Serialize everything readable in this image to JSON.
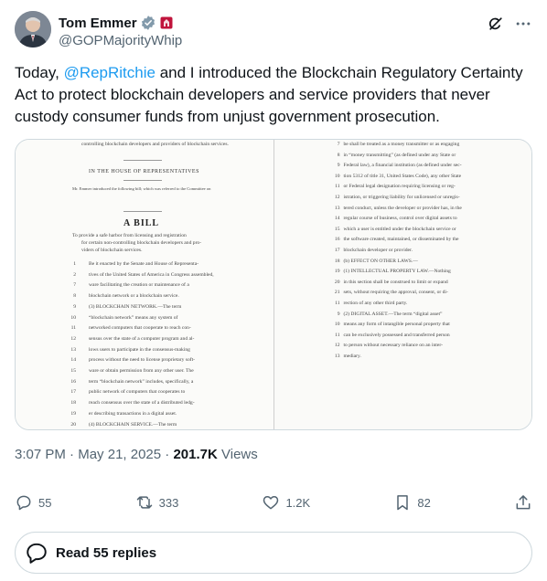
{
  "author": {
    "display_name": "Tom Emmer",
    "handle": "@GOPMajorityWhip",
    "verified_badge_color": "#829aab",
    "affiliation_badge_color": "#c0143c"
  },
  "tweet": {
    "text_before": "Today, ",
    "mention": "@RepRitchie",
    "text_after": " and I introduced the Blockchain Regulatory Certainty Act to protect blockchain developers and service providers that never custody consumer funds from unjust government prosecution."
  },
  "document": {
    "left_page": {
      "top_line": "controlling blockchain developers and providers of blockchain services.",
      "house": "IN THE HOUSE OF REPRESENTATIVES",
      "intro": "Mr. Emmer introduced the following bill; which was referred to the Committee on",
      "title": "A BILL",
      "purpose": [
        "To provide a safe harbor from licensing and registration",
        "for certain non-controlling blockchain developers and pro-",
        "viders of blockchain services."
      ],
      "numbered_lines": [
        {
          "n": "1",
          "t": "Be it enacted by the Senate and House of Representa-"
        },
        {
          "n": "2",
          "t": "tives of the United States of America in Congress assembled,"
        },
        {
          "n": "7",
          "t": "ware facilitating the creation or maintenance of a"
        },
        {
          "n": "8",
          "t": "blockchain network or a blockchain service."
        },
        {
          "n": "9",
          "t": "(3) BLOCKCHAIN NETWORK.—The term"
        },
        {
          "n": "10",
          "t": "“blockchain network” means any system of"
        },
        {
          "n": "11",
          "t": "networked computers that cooperate to reach con-"
        },
        {
          "n": "12",
          "t": "sensus over the state of a computer program and al-"
        },
        {
          "n": "13",
          "t": "lows users to participate in the consensus-making"
        },
        {
          "n": "14",
          "t": "process without the need to license proprietary soft-"
        },
        {
          "n": "15",
          "t": "ware or obtain permission from any other user. The"
        },
        {
          "n": "16",
          "t": "term “blockchain network” includes, specifically, a"
        },
        {
          "n": "17",
          "t": "public network of computers that cooperates to"
        },
        {
          "n": "18",
          "t": "reach consensus over the state of a distributed ledg-"
        },
        {
          "n": "19",
          "t": "er describing transactions in a digital asset."
        },
        {
          "n": "20",
          "t": "(4) BLOCKCHAIN SERVICE.—The term"
        }
      ]
    },
    "right_page": {
      "numbered_lines": [
        {
          "n": "7",
          "t": "be shall be treated as a money transmitter or as engaging"
        },
        {
          "n": "8",
          "t": "in “money transmitting” (as defined under any State or"
        },
        {
          "n": "9",
          "t": "Federal law), a financial institution (as defined under sec-"
        },
        {
          "n": "10",
          "t": "tion 5312 of title 31, United States Code), any other State"
        },
        {
          "n": "11",
          "t": "or Federal legal designation requiring licensing or reg-"
        },
        {
          "n": "12",
          "t": "istration, or triggering liability for unlicensed or unregis-"
        },
        {
          "n": "13",
          "t": "tered conduct, unless the developer or provider has, in the"
        },
        {
          "n": "14",
          "t": "regular course of business, control over digital assets to"
        },
        {
          "n": "15",
          "t": "which a user is entitled under the blockchain service or"
        },
        {
          "n": "16",
          "t": "the software created, maintained, or disseminated by the"
        },
        {
          "n": "17",
          "t": "blockchain developer or provider."
        },
        {
          "n": "18",
          "t": "(b) EFFECT ON OTHER LAWS.—"
        },
        {
          "n": "19",
          "t": "(1) INTELLECTUAL PROPERTY LAW.—Nothing"
        },
        {
          "n": "20",
          "t": "in this section shall be construed to limit or expand"
        },
        {
          "n": "21",
          "t": "sets, without requiring the approval, consent, or di-"
        },
        {
          "n": "11",
          "t": "rection of any other third party."
        },
        {
          "n": "9",
          "t": "(2) DIGITAL ASSET.—The term “digital asset”"
        },
        {
          "n": "10",
          "t": "means any form of intangible personal property that"
        },
        {
          "n": "11",
          "t": "can be exclusively possessed and transferred person"
        },
        {
          "n": "12",
          "t": "to person without necessary reliance on an inter-"
        },
        {
          "n": "13",
          "t": "mediary."
        }
      ]
    }
  },
  "meta": {
    "time": "3:07 PM",
    "separator": " · ",
    "date": "May 21, 2025",
    "views_count": "201.7K",
    "views_label": " Views"
  },
  "actions": {
    "replies": "55",
    "reposts": "333",
    "likes": "1.2K",
    "bookmarks": "82"
  },
  "read_replies": {
    "label": "Read 55 replies"
  },
  "colors": {
    "link": "#1d9bf0",
    "secondary_text": "#536471",
    "border": "#cfd9de"
  }
}
